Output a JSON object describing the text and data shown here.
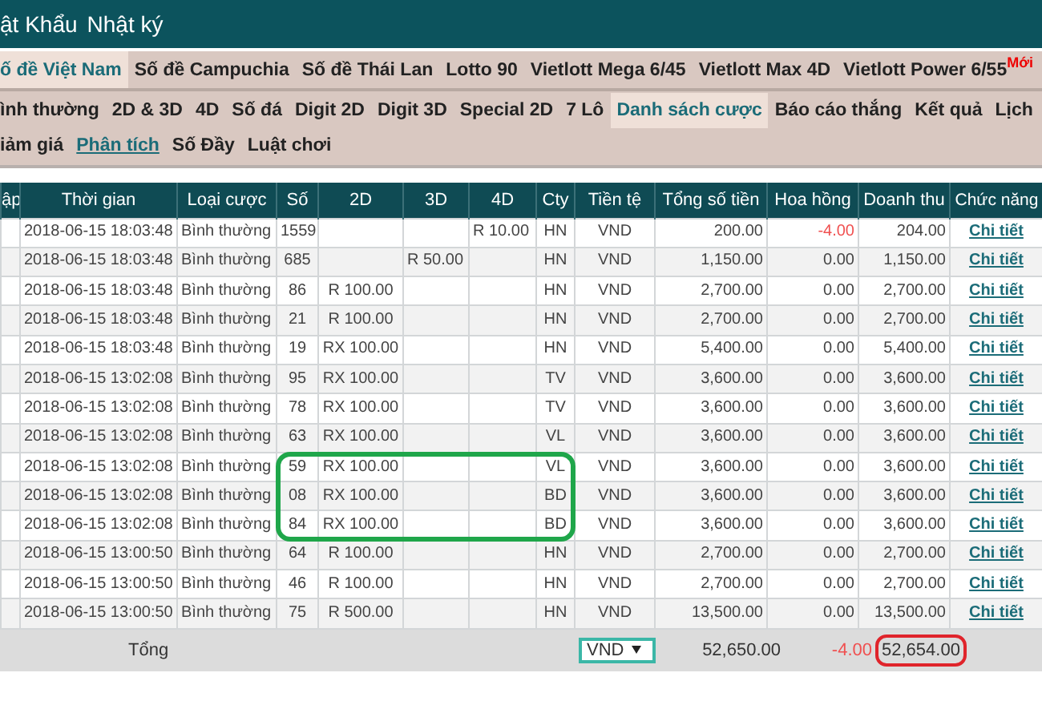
{
  "top_menu": [
    {
      "label": "ật Khẩu"
    },
    {
      "label": "Nhật ký"
    }
  ],
  "game_tabs": [
    {
      "label": "ố đề Việt Nam",
      "selected": true
    },
    {
      "label": "Số đề Campuchia",
      "selected": false
    },
    {
      "label": "Số đề Thái Lan",
      "selected": false
    },
    {
      "label": "Lotto 90",
      "selected": false
    },
    {
      "label": "Vietlott Mega 6/45",
      "selected": false
    },
    {
      "label": "Vietlott Max 4D",
      "selected": false
    },
    {
      "label": "Vietlott Power 6/55",
      "selected": false,
      "badge": "Mới"
    }
  ],
  "sub_menu": [
    [
      {
        "label": "ình thường",
        "selected": false
      },
      {
        "label": "2D & 3D",
        "selected": false
      },
      {
        "label": "4D",
        "selected": false
      },
      {
        "label": "Số đá",
        "selected": false
      },
      {
        "label": "Digit 2D",
        "selected": false
      },
      {
        "label": "Digit 3D",
        "selected": false
      },
      {
        "label": "Special 2D",
        "selected": false
      },
      {
        "label": "7 Lô",
        "selected": false
      },
      {
        "label": "Danh sách cược",
        "selected": true
      },
      {
        "label": "Báo cáo thắng",
        "selected": false
      },
      {
        "label": "Kết quả",
        "selected": false
      },
      {
        "label": "Lịch",
        "selected": false
      }
    ],
    [
      {
        "label": "iảm giá",
        "selected": false,
        "kind": "plain"
      },
      {
        "label": "Phân tích",
        "selected": false,
        "kind": "link"
      },
      {
        "label": "Số Đầy",
        "selected": false,
        "kind": "plain"
      },
      {
        "label": "Luật chơi",
        "selected": false,
        "kind": "plain"
      }
    ]
  ],
  "table": {
    "columns": [
      "ập",
      "Thời gian",
      "Loại cược",
      "Số",
      "2D",
      "3D",
      "4D",
      "Cty",
      "Tiền tệ",
      "Tổng số tiền",
      "Hoa hồng",
      "Doanh thu",
      "Chức năng"
    ],
    "rows": [
      {
        "time": "2018-06-15 18:03:48",
        "type": "Bình thường",
        "number": "1559",
        "d2": "",
        "d3": "",
        "d4": "R 10.00",
        "cty": "HN",
        "currency": "VND",
        "total": "200.00",
        "commission": "-4.00",
        "commission_negative": true,
        "revenue": "204.00",
        "action": "Chi tiết",
        "circled": false
      },
      {
        "time": "2018-06-15 18:03:48",
        "type": "Bình thường",
        "number": "685",
        "d2": "",
        "d3": "R 50.00",
        "d4": "",
        "cty": "HN",
        "currency": "VND",
        "total": "1,150.00",
        "commission": "0.00",
        "commission_negative": false,
        "revenue": "1,150.00",
        "action": "Chi tiết",
        "circled": false
      },
      {
        "time": "2018-06-15 18:03:48",
        "type": "Bình thường",
        "number": "86",
        "d2": "R 100.00",
        "d3": "",
        "d4": "",
        "cty": "HN",
        "currency": "VND",
        "total": "2,700.00",
        "commission": "0.00",
        "commission_negative": false,
        "revenue": "2,700.00",
        "action": "Chi tiết",
        "circled": false
      },
      {
        "time": "2018-06-15 18:03:48",
        "type": "Bình thường",
        "number": "21",
        "d2": "R 100.00",
        "d3": "",
        "d4": "",
        "cty": "HN",
        "currency": "VND",
        "total": "2,700.00",
        "commission": "0.00",
        "commission_negative": false,
        "revenue": "2,700.00",
        "action": "Chi tiết",
        "circled": false
      },
      {
        "time": "2018-06-15 18:03:48",
        "type": "Bình thường",
        "number": "19",
        "d2": "RX 100.00",
        "d3": "",
        "d4": "",
        "cty": "HN",
        "currency": "VND",
        "total": "5,400.00",
        "commission": "0.00",
        "commission_negative": false,
        "revenue": "5,400.00",
        "action": "Chi tiết",
        "circled": false
      },
      {
        "time": "2018-06-15 13:02:08",
        "type": "Bình thường",
        "number": "95",
        "d2": "RX 100.00",
        "d3": "",
        "d4": "",
        "cty": "TV",
        "currency": "VND",
        "total": "3,600.00",
        "commission": "0.00",
        "commission_negative": false,
        "revenue": "3,600.00",
        "action": "Chi tiết",
        "circled": false
      },
      {
        "time": "2018-06-15 13:02:08",
        "type": "Bình thường",
        "number": "78",
        "d2": "RX 100.00",
        "d3": "",
        "d4": "",
        "cty": "TV",
        "currency": "VND",
        "total": "3,600.00",
        "commission": "0.00",
        "commission_negative": false,
        "revenue": "3,600.00",
        "action": "Chi tiết",
        "circled": false
      },
      {
        "time": "2018-06-15 13:02:08",
        "type": "Bình thường",
        "number": "63",
        "d2": "RX 100.00",
        "d3": "",
        "d4": "",
        "cty": "VL",
        "currency": "VND",
        "total": "3,600.00",
        "commission": "0.00",
        "commission_negative": false,
        "revenue": "3,600.00",
        "action": "Chi tiết",
        "circled": false
      },
      {
        "time": "2018-06-15 13:02:08",
        "type": "Bình thường",
        "number": "59",
        "d2": "RX 100.00",
        "d3": "",
        "d4": "",
        "cty": "VL",
        "currency": "VND",
        "total": "3,600.00",
        "commission": "0.00",
        "commission_negative": false,
        "revenue": "3,600.00",
        "action": "Chi tiết",
        "circled": true
      },
      {
        "time": "2018-06-15 13:02:08",
        "type": "Bình thường",
        "number": "08",
        "d2": "RX 100.00",
        "d3": "",
        "d4": "",
        "cty": "BD",
        "currency": "VND",
        "total": "3,600.00",
        "commission": "0.00",
        "commission_negative": false,
        "revenue": "3,600.00",
        "action": "Chi tiết",
        "circled": true
      },
      {
        "time": "2018-06-15 13:02:08",
        "type": "Bình thường",
        "number": "84",
        "d2": "RX 100.00",
        "d3": "",
        "d4": "",
        "cty": "BD",
        "currency": "VND",
        "total": "3,600.00",
        "commission": "0.00",
        "commission_negative": false,
        "revenue": "3,600.00",
        "action": "Chi tiết",
        "circled": true
      },
      {
        "time": "2018-06-15 13:00:50",
        "type": "Bình thường",
        "number": "64",
        "d2": "R 100.00",
        "d3": "",
        "d4": "",
        "cty": "HN",
        "currency": "VND",
        "total": "2,700.00",
        "commission": "0.00",
        "commission_negative": false,
        "revenue": "2,700.00",
        "action": "Chi tiết",
        "circled": false
      },
      {
        "time": "2018-06-15 13:00:50",
        "type": "Bình thường",
        "number": "46",
        "d2": "R 100.00",
        "d3": "",
        "d4": "",
        "cty": "HN",
        "currency": "VND",
        "total": "2,700.00",
        "commission": "0.00",
        "commission_negative": false,
        "revenue": "2,700.00",
        "action": "Chi tiết",
        "circled": false
      },
      {
        "time": "2018-06-15 13:00:50",
        "type": "Bình thường",
        "number": "75",
        "d2": "R 500.00",
        "d3": "",
        "d4": "",
        "cty": "HN",
        "currency": "VND",
        "total": "13,500.00",
        "commission": "0.00",
        "commission_negative": false,
        "revenue": "13,500.00",
        "action": "Chi tiết",
        "circled": false
      }
    ],
    "footer": {
      "label": "Tổng",
      "currency": "VND",
      "total": "52,650.00",
      "commission": "-4.00",
      "commission_negative": true,
      "revenue": "52,654.00",
      "revenue_circled": true
    }
  }
}
